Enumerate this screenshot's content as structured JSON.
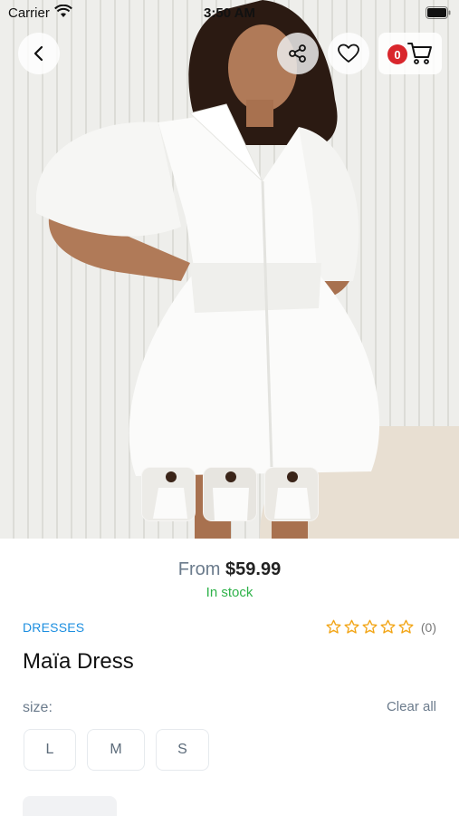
{
  "status_bar": {
    "carrier": "Carrier",
    "time": "3:50 AM",
    "icons": [
      "wifi-icon",
      "battery-icon"
    ]
  },
  "header": {
    "back_icon": "chevron-left-icon",
    "share_icon": "share-icon",
    "favorite_icon": "heart-icon",
    "cart_icon": "cart-icon",
    "cart_count": "0"
  },
  "gallery": {
    "thumbnails": 3
  },
  "product": {
    "price_prefix": "From",
    "price": "$59.99",
    "stock_status": "In stock",
    "category": "DRESSES",
    "rating": {
      "value": 0,
      "max": 5,
      "count_label": "(0)"
    },
    "title": "Maïa Dress"
  },
  "size_selector": {
    "label": "size:",
    "clear_label": "Clear all",
    "options": [
      "L",
      "M",
      "S"
    ]
  },
  "colors": {
    "accent_blue": "#1d8fe0",
    "stock_green": "#2fb24a",
    "star_orange": "#f2a516",
    "badge_red": "#d9262c",
    "muted_text": "#6b7b8c"
  }
}
